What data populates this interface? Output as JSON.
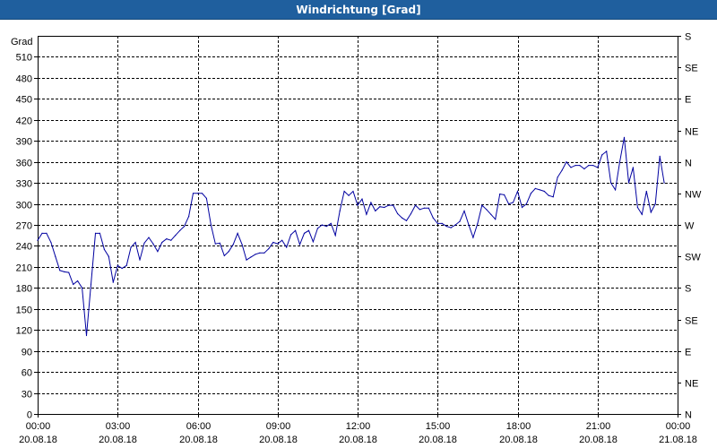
{
  "window": {
    "title": "Windrichtung [Grad]"
  },
  "colors": {
    "titlebar": "#1f5f9e",
    "line": "#0000a0",
    "grid": "#000000",
    "background": "#ffffff"
  },
  "chart_data": {
    "type": "line",
    "title": "Windrichtung [Grad]",
    "ylabel": "Grad",
    "ylim": [
      0,
      540
    ],
    "yticks": [
      0,
      30,
      60,
      90,
      120,
      150,
      180,
      210,
      240,
      270,
      300,
      330,
      360,
      390,
      420,
      450,
      480,
      510
    ],
    "right_axis_labels": [
      "N",
      "NE",
      "E",
      "SE",
      "S",
      "SW",
      "W",
      "NW",
      "N",
      "NE",
      "E",
      "SE",
      "S"
    ],
    "x_ticks": [
      {
        "time": "00:00",
        "date": "20.08.18"
      },
      {
        "time": "03:00",
        "date": "20.08.18"
      },
      {
        "time": "06:00",
        "date": "20.08.18"
      },
      {
        "time": "09:00",
        "date": "20.08.18"
      },
      {
        "time": "12:00",
        "date": "20.08.18"
      },
      {
        "time": "15:00",
        "date": "20.08.18"
      },
      {
        "time": "18:00",
        "date": "20.08.18"
      },
      {
        "time": "21:00",
        "date": "20.08.18"
      },
      {
        "time": "00:00",
        "date": "21.08.18"
      }
    ],
    "xlim": [
      "20.08.18 00:00",
      "21.08.18 00:00"
    ],
    "grid": true,
    "series": [
      {
        "values": [
          [
            "00:00",
            248
          ],
          [
            "00:10",
            258
          ],
          [
            "00:20",
            258
          ],
          [
            "00:30",
            245
          ],
          [
            "00:40",
            225
          ],
          [
            "00:50",
            205
          ],
          [
            "01:00",
            203
          ],
          [
            "01:10",
            202
          ],
          [
            "01:20",
            185
          ],
          [
            "01:30",
            190
          ],
          [
            "01:40",
            180
          ],
          [
            "01:50",
            112
          ],
          [
            "02:00",
            185
          ],
          [
            "02:10",
            258
          ],
          [
            "02:20",
            258
          ],
          [
            "02:30",
            235
          ],
          [
            "02:40",
            225
          ],
          [
            "02:50",
            188
          ],
          [
            "03:00",
            212
          ],
          [
            "03:10",
            208
          ],
          [
            "03:20",
            212
          ],
          [
            "03:30",
            238
          ],
          [
            "03:40",
            245
          ],
          [
            "03:50",
            220
          ],
          [
            "04:00",
            244
          ],
          [
            "04:10",
            252
          ],
          [
            "04:20",
            243
          ],
          [
            "04:30",
            232
          ],
          [
            "04:40",
            245
          ],
          [
            "04:50",
            250
          ],
          [
            "05:00",
            248
          ],
          [
            "05:10",
            255
          ],
          [
            "05:20",
            262
          ],
          [
            "05:30",
            268
          ],
          [
            "05:40",
            282
          ],
          [
            "05:50",
            315
          ],
          [
            "06:00",
            315
          ],
          [
            "06:10",
            315
          ],
          [
            "06:20",
            308
          ],
          [
            "06:30",
            270
          ],
          [
            "06:40",
            243
          ],
          [
            "06:50",
            244
          ],
          [
            "07:00",
            226
          ],
          [
            "07:10",
            232
          ],
          [
            "07:20",
            242
          ],
          [
            "07:30",
            258
          ],
          [
            "07:40",
            242
          ],
          [
            "07:50",
            220
          ],
          [
            "08:00",
            224
          ],
          [
            "08:10",
            228
          ],
          [
            "08:20",
            230
          ],
          [
            "08:30",
            230
          ],
          [
            "08:40",
            236
          ],
          [
            "08:50",
            245
          ],
          [
            "09:00",
            243
          ],
          [
            "09:10",
            248
          ],
          [
            "09:20",
            238
          ],
          [
            "09:30",
            256
          ],
          [
            "09:40",
            262
          ],
          [
            "09:50",
            242
          ],
          [
            "10:00",
            258
          ],
          [
            "10:10",
            262
          ],
          [
            "10:20",
            246
          ],
          [
            "10:30",
            265
          ],
          [
            "10:40",
            270
          ],
          [
            "10:50",
            268
          ],
          [
            "11:00",
            272
          ],
          [
            "11:10",
            255
          ],
          [
            "11:20",
            290
          ],
          [
            "11:30",
            318
          ],
          [
            "11:40",
            312
          ],
          [
            "11:50",
            318
          ],
          [
            "12:00",
            298
          ],
          [
            "12:10",
            307
          ],
          [
            "12:20",
            285
          ],
          [
            "12:30",
            302
          ],
          [
            "12:40",
            290
          ],
          [
            "12:50",
            296
          ],
          [
            "13:00",
            295
          ],
          [
            "13:10",
            298
          ],
          [
            "13:20",
            298
          ],
          [
            "13:30",
            286
          ],
          [
            "13:40",
            280
          ],
          [
            "13:50",
            276
          ],
          [
            "14:00",
            286
          ],
          [
            "14:10",
            298
          ],
          [
            "14:20",
            292
          ],
          [
            "14:30",
            294
          ],
          [
            "14:40",
            294
          ],
          [
            "14:50",
            280
          ],
          [
            "15:00",
            272
          ],
          [
            "15:10",
            272
          ],
          [
            "15:20",
            268
          ],
          [
            "15:30",
            266
          ],
          [
            "15:40",
            270
          ],
          [
            "15:50",
            275
          ],
          [
            "16:00",
            290
          ],
          [
            "16:10",
            270
          ],
          [
            "16:20",
            252
          ],
          [
            "16:30",
            272
          ],
          [
            "16:40",
            298
          ],
          [
            "16:50",
            292
          ],
          [
            "17:00",
            285
          ],
          [
            "17:10",
            278
          ],
          [
            "17:20",
            314
          ],
          [
            "17:30",
            313
          ],
          [
            "17:40",
            300
          ],
          [
            "17:50",
            302
          ],
          [
            "18:00",
            318
          ],
          [
            "18:10",
            295
          ],
          [
            "18:20",
            300
          ],
          [
            "18:30",
            315
          ],
          [
            "18:40",
            322
          ],
          [
            "18:50",
            320
          ],
          [
            "19:00",
            318
          ],
          [
            "19:10",
            312
          ],
          [
            "19:20",
            310
          ],
          [
            "19:30",
            338
          ],
          [
            "19:40",
            348
          ],
          [
            "19:50",
            360
          ],
          [
            "20:00",
            352
          ],
          [
            "20:10",
            355
          ],
          [
            "20:20",
            355
          ],
          [
            "20:30",
            350
          ],
          [
            "20:40",
            355
          ],
          [
            "20:50",
            355
          ],
          [
            "21:00",
            352
          ],
          [
            "21:10",
            370
          ],
          [
            "21:20",
            375
          ],
          [
            "21:30",
            330
          ],
          [
            "21:40",
            320
          ],
          [
            "21:50",
            360
          ],
          [
            "22:00",
            395
          ],
          [
            "22:10",
            330
          ],
          [
            "22:20",
            352
          ],
          [
            "22:30",
            295
          ],
          [
            "22:40",
            285
          ],
          [
            "22:50",
            318
          ],
          [
            "23:00",
            288
          ],
          [
            "23:10",
            300
          ],
          [
            "23:20",
            368
          ],
          [
            "23:30",
            330
          ]
        ]
      }
    ]
  }
}
